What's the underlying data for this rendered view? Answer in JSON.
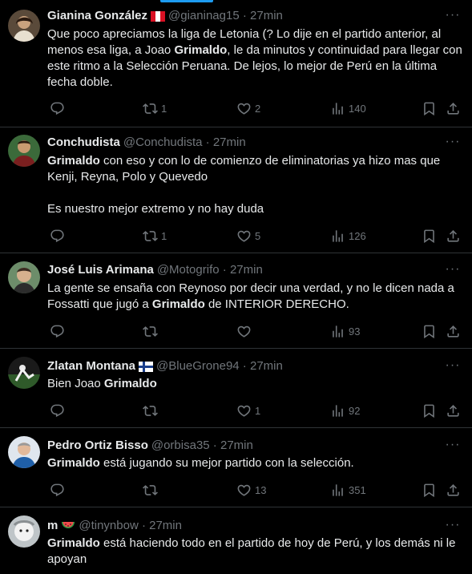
{
  "tweets": [
    {
      "name": "Gianina González",
      "flag": "peru",
      "handle": "@gianinag15",
      "time": "27min",
      "body": [
        "Que poco apreciamos la liga de Letonia (?  Lo dije en el partido anterior, al menos esa liga, a Joao ",
        {
          "b": "Grimaldo"
        },
        ", le da minutos y continuidad para llegar con este ritmo a la Selección Peruana. De lejos, lo mejor de Perú en la última fecha doble."
      ],
      "replies": "",
      "retweets": "1",
      "likes": "2",
      "views": "140"
    },
    {
      "name": "Conchudista",
      "flag": "",
      "handle": "@Conchudista",
      "time": "27min",
      "body": [
        {
          "b": "Grimaldo"
        },
        " con eso y con lo de comienzo de eliminatorias ya hizo mas que Kenji, Reyna, Polo y Quevedo",
        {
          "br": 2
        },
        "Es nuestro mejor extremo y no hay duda"
      ],
      "replies": "",
      "retweets": "1",
      "likes": "5",
      "views": "126"
    },
    {
      "name": "José Luis Arimana",
      "flag": "",
      "handle": "@Motogrifo",
      "time": "27min",
      "body": [
        "La gente se ensaña con Reynoso por decir una verdad, y no le dicen nada a Fossatti que jugó a ",
        {
          "b": "Grimaldo"
        },
        " de INTERIOR DERECHO."
      ],
      "replies": "",
      "retweets": "",
      "likes": "",
      "views": "93"
    },
    {
      "name": "Zlatan Montana",
      "flag": "finland",
      "handle": "@BlueGrone94",
      "time": "27min",
      "body": [
        "Bien Joao ",
        {
          "b": "Grimaldo"
        }
      ],
      "replies": "",
      "retweets": "",
      "likes": "1",
      "views": "92"
    },
    {
      "name": "Pedro Ortiz Bisso",
      "flag": "",
      "handle": "@orbisa35",
      "time": "27min",
      "body": [
        {
          "b": "Grimaldo"
        },
        " está jugando su mejor partido con la selección."
      ],
      "replies": "",
      "retweets": "",
      "likes": "13",
      "views": "351"
    },
    {
      "name": "m",
      "flag": "watermelon",
      "handle": "@tinynbow",
      "time": "27min",
      "body": [
        {
          "b": "Grimaldo"
        },
        " está haciendo todo en el partido de hoy de Perú, y los demás ni le apoyan"
      ],
      "replies": "",
      "retweets": "",
      "likes": "",
      "views": ""
    }
  ],
  "colors": {
    "background": "#000000",
    "text": "#e7e9ea",
    "muted": "#71767b",
    "divider": "#2f3336",
    "accent": "#1d9bf0"
  },
  "icons": [
    "reply-icon",
    "retweet-icon",
    "like-icon",
    "views-icon",
    "bookmark-icon",
    "share-icon",
    "more-icon"
  ]
}
